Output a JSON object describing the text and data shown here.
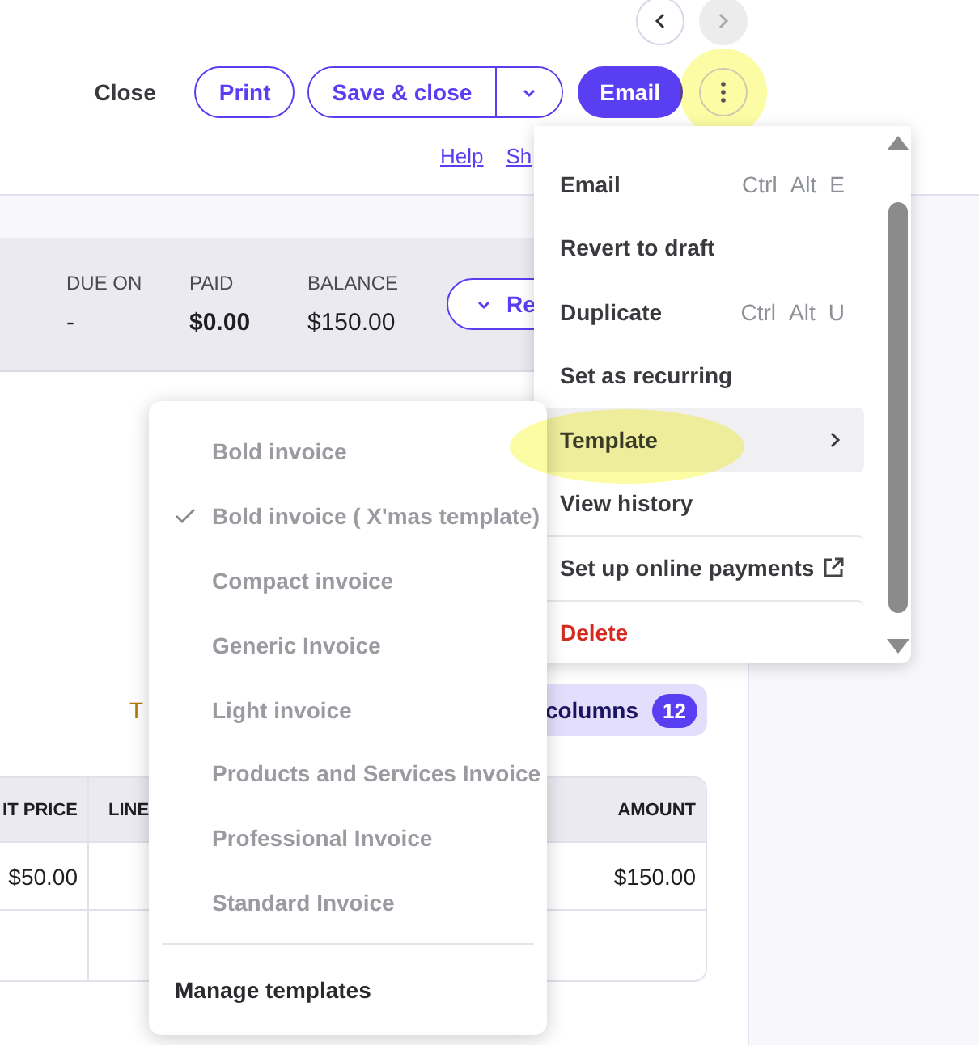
{
  "nav": {
    "prev": {
      "disabled": false
    },
    "next": {
      "disabled": true
    }
  },
  "toolbar": {
    "close": "Close",
    "print": "Print",
    "save": "Save & close",
    "email": "Email"
  },
  "links": [
    "Help",
    "Sh"
  ],
  "summary": [
    {
      "label": "DUE ON",
      "value": "-",
      "bold": false
    },
    {
      "label": "PAID",
      "value": "$0.00",
      "bold": true
    },
    {
      "label": "BALANCE",
      "value": "$150.00",
      "bold": false
    }
  ],
  "summary_button": "Re",
  "table_toolbar": {
    "text": "T",
    "columns_button": "columns",
    "count": "12"
  },
  "table": {
    "columns": [
      "IT PRICE",
      "LINE",
      "AMOUNT"
    ],
    "rows": [
      {
        "unit_price": "$50.00",
        "amount": "$150.00"
      }
    ]
  },
  "more_menu": {
    "items": [
      {
        "label": "Email",
        "shortcut": [
          "Ctrl",
          "Alt",
          "E"
        ],
        "kind": "item",
        "hovered": false,
        "divider_before": false
      },
      {
        "label": "Revert to draft",
        "kind": "item",
        "hovered": false,
        "divider_before": false
      },
      {
        "label": "Duplicate",
        "shortcut": [
          "Ctrl",
          "Alt",
          "U"
        ],
        "kind": "item",
        "hovered": false,
        "divider_before": false
      },
      {
        "label": "Set as recurring",
        "kind": "item",
        "hovered": false,
        "divider_before": false
      },
      {
        "label": "Template",
        "kind": "submenu",
        "hovered": true,
        "divider_before": false
      },
      {
        "label": "View history",
        "kind": "item",
        "hovered": false,
        "divider_before": false
      },
      {
        "label": "Set up online payments",
        "kind": "external",
        "hovered": false,
        "divider_before": true
      },
      {
        "label": "Delete",
        "kind": "danger",
        "hovered": false,
        "divider_before": true
      }
    ]
  },
  "template_menu": {
    "items": [
      {
        "label": "Bold invoice",
        "checked": false
      },
      {
        "label": "Bold invoice ( X'mas template)",
        "checked": true
      },
      {
        "label": "Compact invoice",
        "checked": false
      },
      {
        "label": "Generic Invoice",
        "checked": false
      },
      {
        "label": "Light invoice",
        "checked": false
      },
      {
        "label": "Products and Services Invoice",
        "checked": false
      },
      {
        "label": "Professional Invoice",
        "checked": false
      },
      {
        "label": "Standard Invoice",
        "checked": false
      }
    ],
    "manage": "Manage templates"
  }
}
